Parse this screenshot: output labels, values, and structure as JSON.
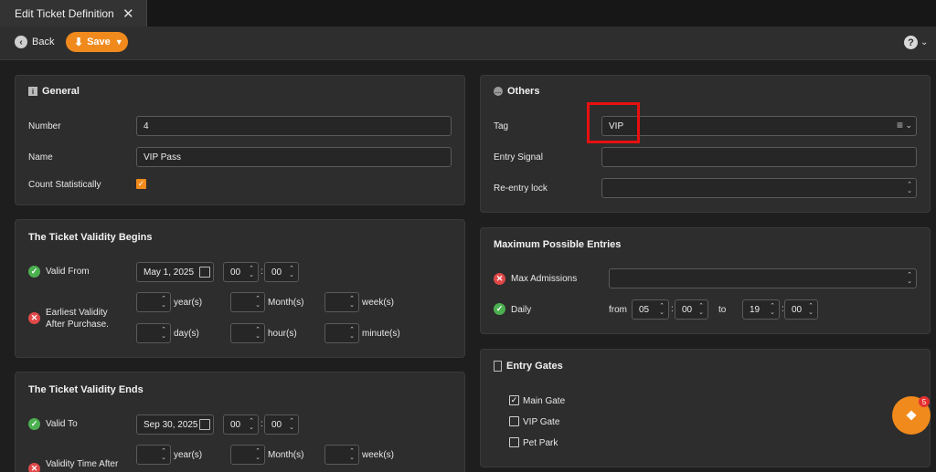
{
  "tab": {
    "title": "Edit Ticket Definition",
    "close": "✕"
  },
  "toolbar": {
    "back": "Back",
    "save": "Save",
    "help": "?"
  },
  "general": {
    "title": "General",
    "number_label": "Number",
    "number_value": "4",
    "name_label": "Name",
    "name_value": "VIP Pass",
    "count_label": "Count Statistically"
  },
  "begins": {
    "title": "The Ticket Validity Begins",
    "valid_from_label": "Valid From",
    "date": "May 1, 2025",
    "hour": "00",
    "minute": "00",
    "earliest_label_1": "Earliest Validity",
    "earliest_label_2": "After Purchase.",
    "units": {
      "year": "year(s)",
      "month": "Month(s)",
      "week": "week(s)",
      "day": "day(s)",
      "hour": "hour(s)",
      "minute": "minute(s)"
    }
  },
  "ends": {
    "title": "The Ticket Validity Ends",
    "valid_to_label": "Valid To",
    "date": "Sep 30, 2025",
    "hour": "00",
    "minute": "00",
    "after_label": "Validity Time After",
    "units": {
      "year": "year(s)",
      "month": "Month(s)",
      "week": "week(s)"
    }
  },
  "others": {
    "title": "Others",
    "tag_label": "Tag",
    "tag_value": "VIP",
    "entry_signal_label": "Entry Signal",
    "reentry_label": "Re-entry lock"
  },
  "max_entries": {
    "title": "Maximum Possible Entries",
    "max_admissions_label": "Max Admissions",
    "daily_label": "Daily",
    "from_label": "from",
    "from_hour": "05",
    "from_minute": "00",
    "to_label": "to",
    "to_hour": "19",
    "to_minute": "00"
  },
  "gates": {
    "title": "Entry Gates",
    "items": [
      {
        "label": "Main Gate",
        "checked": true
      },
      {
        "label": "VIP Gate",
        "checked": false
      },
      {
        "label": "Pet Park",
        "checked": false
      }
    ]
  },
  "chat": {
    "badge": "5"
  },
  "colors": {
    "accent": "#f08a1c",
    "highlight": "#e81010",
    "ok": "#4caf50",
    "error": "#e04848"
  }
}
